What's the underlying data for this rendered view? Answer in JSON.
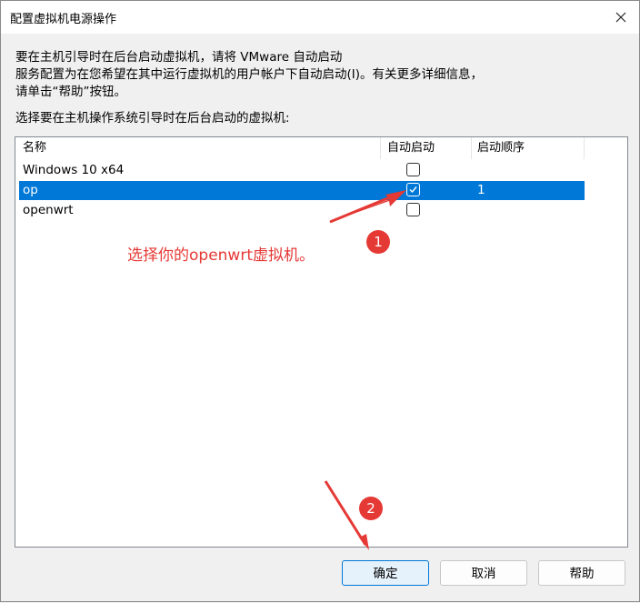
{
  "window": {
    "title": "配置虚拟机电源操作"
  },
  "description": "要在主机引导时在后台启动虚拟机，请将 VMware 自动启动\n服务配置为在您希望在其中运行虚拟机的用户帐户下自动启动(I)。有关更多详细信息，\n请单击“帮助”按钮。",
  "prompt": "选择要在主机操作系统引导时在后台启动的虚拟机:",
  "table": {
    "columns": [
      "名称",
      "自动启动",
      "启动顺序"
    ],
    "rows": [
      {
        "name": "Windows 10 x64",
        "auto_start": false,
        "order": "",
        "selected": false
      },
      {
        "name": "op",
        "auto_start": true,
        "order": "1",
        "selected": true
      },
      {
        "name": "openwrt",
        "auto_start": false,
        "order": "",
        "selected": false
      }
    ]
  },
  "annotation": {
    "text": "选择你的openwrt虚拟机。",
    "color": "#e53935",
    "badge1": "1",
    "badge2": "2"
  },
  "buttons": {
    "ok": "确定",
    "cancel": "取消",
    "help": "帮助"
  },
  "colors": {
    "selection": "#0078d7",
    "accent": "#e53935"
  }
}
